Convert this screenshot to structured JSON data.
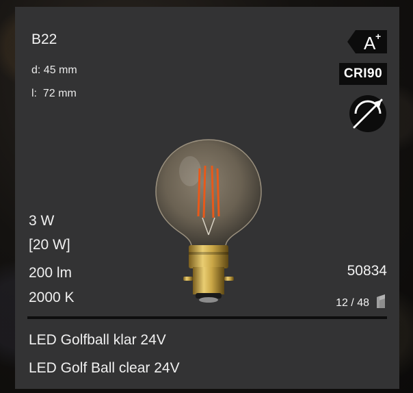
{
  "product": {
    "socket": "B22",
    "diameter": "d: 45 mm",
    "length": "l:  72 mm",
    "power": "3 W",
    "equivalent_power": "[20 W]",
    "lumen": "200 lm",
    "color_temperature": "2000 K",
    "article_number": "50834",
    "pack_quantity": "12 / 48",
    "name_de": "LED Golfball klar 24V",
    "name_en": "LED Golf Ball clear 24V"
  },
  "badges": {
    "energy_class": "A",
    "energy_class_plus": "+",
    "cri": "CRI90"
  },
  "icons": {
    "dimmable": "dimmable-icon",
    "bulb": "golf-ball-bulb-image",
    "pack": "package-icon"
  },
  "colors": {
    "card_background": "#333334",
    "text": "#f2f2f2",
    "badge_background": "#0c0c0c",
    "filament": "#e8591a",
    "base_brass": "#c9a646"
  }
}
